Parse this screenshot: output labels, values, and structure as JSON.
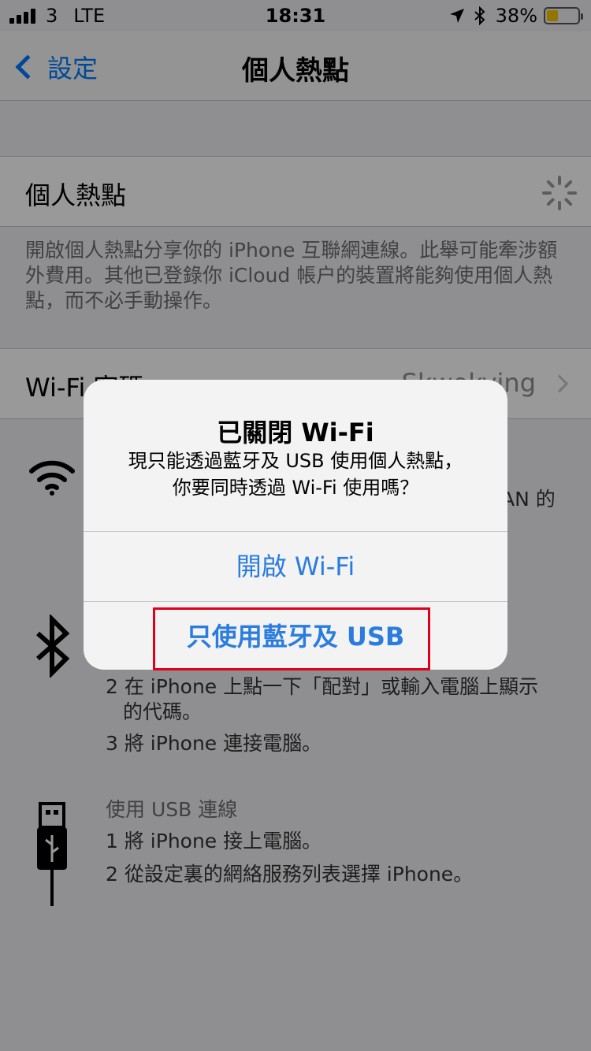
{
  "status_bar": {
    "carrier": "3",
    "network": "LTE",
    "time": "18:31",
    "battery": "38%",
    "location_icon": "location-arrow-icon",
    "bluetooth_icon": "bluetooth-icon"
  },
  "nav": {
    "back_label": "設定",
    "title": "個人熱點"
  },
  "hotspot_cell": {
    "label": "個人熱點"
  },
  "hotspot_footer": {
    "text": "開啟個人熱點分享你的 iPhone 互聯網連線。此舉可能牽涉額外費用。其他已登錄你 iCloud 帳户的裝置將能夠使用個人熱點，而不必手動操作。"
  },
  "wifi_password_cell": {
    "label": "Wi-Fi 密碼",
    "value": "Skwokying"
  },
  "wifi_info": {
    "partial_text": "AN 的"
  },
  "bluetooth_info": {
    "step2": "2 在 iPhone 上點一下「配對」或輸入電腦上顯示",
    "step2_cont": "的代碼。",
    "step3": "3 將 iPhone 連接電腦。"
  },
  "usb_info": {
    "heading": "使用 USB 連線",
    "step1": "1 將 iPhone 接上電腦。",
    "step2": "2 從設定裏的網絡服務列表選擇 iPhone。"
  },
  "alert": {
    "title": "已關閉 Wi-Fi",
    "message_line1": "現只能透過藍牙及 USB 使用個人熱點，",
    "message_line2": "你要同時透過 Wi-Fi 使用嗎？",
    "button_wifi": "開啟 Wi-Fi",
    "button_bt_usb": "只使用藍牙及 USB"
  },
  "colors": {
    "accent": "#007aff",
    "alert_button": "#2a7dde",
    "highlight": "#e0001b"
  }
}
